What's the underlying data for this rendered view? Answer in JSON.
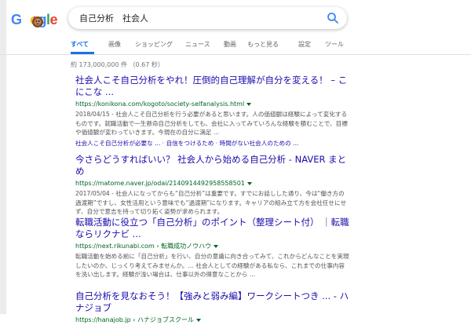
{
  "header": {
    "logo_letters": [
      "G",
      "o",
      "o",
      "g",
      "l",
      "e"
    ],
    "query": "自己分析　社会人"
  },
  "tabs": [
    {
      "label": "すべて",
      "active": true
    },
    {
      "label": "画像"
    },
    {
      "label": "ショッピング"
    },
    {
      "label": "ニュース"
    },
    {
      "label": "動画"
    },
    {
      "label": "もっと見る"
    },
    {
      "label": "設定"
    },
    {
      "label": "ツール"
    }
  ],
  "stats": "約 173,000,000 件 （0.67 秒）",
  "results": [
    {
      "title": "社会人こそ自己分析をやれ！圧倒的自己理解が自分を変える！ – こにこな ...",
      "url": "https://konikona.com/kogoto/society-selfanalysis.html",
      "snippet": "2018/04/15 - 社会人こそ自己分析を行う必要があると思います。人の価値観は経験によって変化するものです。就職活動で一生懸命自己分析をしても、会社に入ってみていろんな経験を積むことで、目標や価値観が変わっていきます。今現在の自分に満足 ...",
      "links": [
        "社会人こそ自己分析が必要な ...",
        "自信をつけるため",
        "時間がない社会人のための ..."
      ]
    },
    {
      "title": "今さらどうすればいい？ 社会人から始める自己分析 - NAVER まとめ",
      "url": "https://matome.naver.jp/odai/2140914492958558501",
      "snippet": "2017/05/04 - 社会人になってからも“自己分析”は重要です。すでにお話しした通り、今は“働き方の過渡期”ですし、女性活用という意味でも“過渡期”になります。キャリアの組み立て方を会社任せにせず、自分で意志を持って切り拓く姿勢が求められます。"
    },
    {
      "title": "転職活動に役立つ「自己分析」のポイント（整理シート付） ｜転職ならリクナビ ...",
      "url": "https://next.rikunabi.com › 転職成功ノウハウ",
      "snippet": "転職活動を始める前に「自己分析」を行い、自分の意識に向き合ってみて、これからどんなことを実現したいのか、じっくり考えてみませんか。… 社会人としての経験がある私なら、これまでの仕事内容を洗い出します。経験が浅い場合は、仕事以外の得意なことから ..."
    },
    {
      "title": "自己分析を見なおそう！【強みと弱み編】ワークシートつき ... - ハナジョブ",
      "url": "https://hanajob.jp › ハナジョブスクール"
    }
  ]
}
